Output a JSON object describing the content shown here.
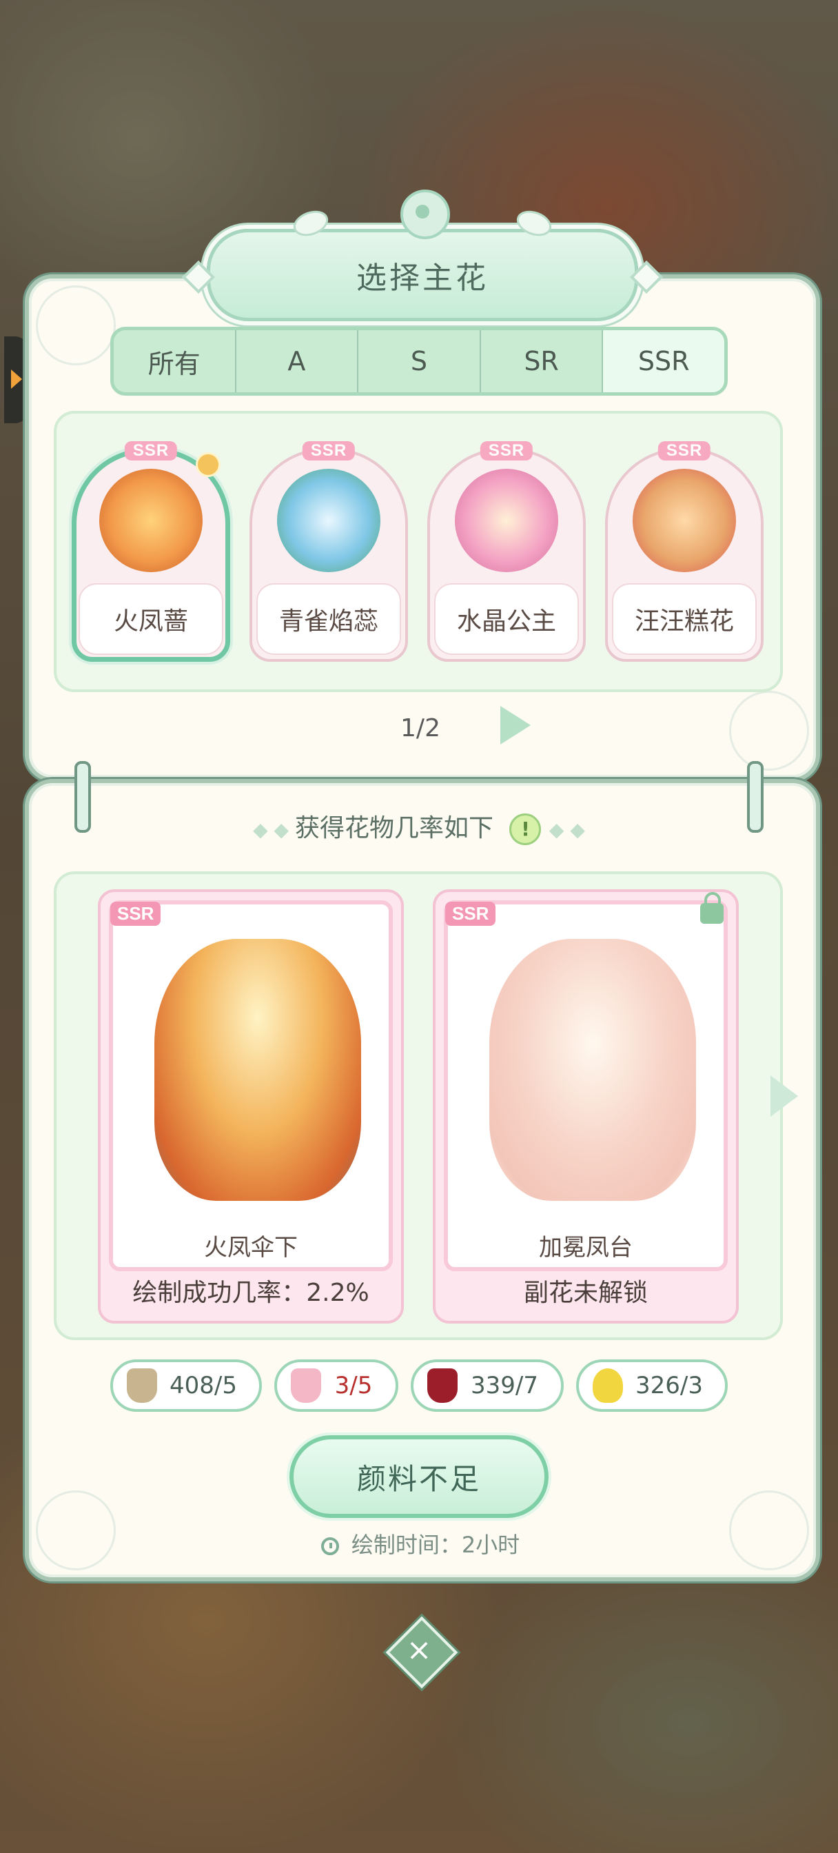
{
  "dialog": {
    "title": "选择主花"
  },
  "tabs": [
    {
      "label": "所有",
      "active": false
    },
    {
      "label": "A",
      "active": false
    },
    {
      "label": "S",
      "active": false
    },
    {
      "label": "SR",
      "active": false
    },
    {
      "label": "SSR",
      "active": true
    }
  ],
  "flowers": [
    {
      "rarity": "SSR",
      "name": "火凤蔷",
      "selected": true,
      "color": "#f29a4a"
    },
    {
      "rarity": "SSR",
      "name": "青雀焰蕊",
      "selected": false,
      "color": "#7fc7e6"
    },
    {
      "rarity": "SSR",
      "name": "水晶公主",
      "selected": false,
      "color": "#f4a3c4"
    },
    {
      "rarity": "SSR",
      "name": "汪汪糕花",
      "selected": false,
      "color": "#e9a76b"
    }
  ],
  "pager": {
    "text": "1/2"
  },
  "probability": {
    "header": "获得花物几率如下",
    "info_icon": "!",
    "cards": [
      {
        "rarity": "SSR",
        "name": "火凤伞下",
        "footer": "绘制成功几率：2.2%",
        "locked": false,
        "color": "#f3b35a"
      },
      {
        "rarity": "SSR",
        "name": "加冕凤台",
        "footer": "副花未解锁",
        "locked": true,
        "color": "#f5c9b9"
      }
    ]
  },
  "resources": [
    {
      "icon": "beige-paint-tube-icon",
      "value": "408/5",
      "sufficient": true,
      "color": "#c8b58f"
    },
    {
      "icon": "pink-paint-tube-icon",
      "value": "3/5",
      "sufficient": false,
      "color": "#f3b7c6"
    },
    {
      "icon": "red-paint-tube-icon",
      "value": "339/7",
      "sufficient": true,
      "color": "#9c1e2a"
    },
    {
      "icon": "yellow-paint-jar-icon",
      "value": "326/3",
      "sufficient": true,
      "color": "#f2d640"
    }
  ],
  "action": {
    "label": "颜料不足"
  },
  "draw_time": {
    "text": "绘制时间：2小时"
  },
  "close": {
    "label": "×"
  }
}
